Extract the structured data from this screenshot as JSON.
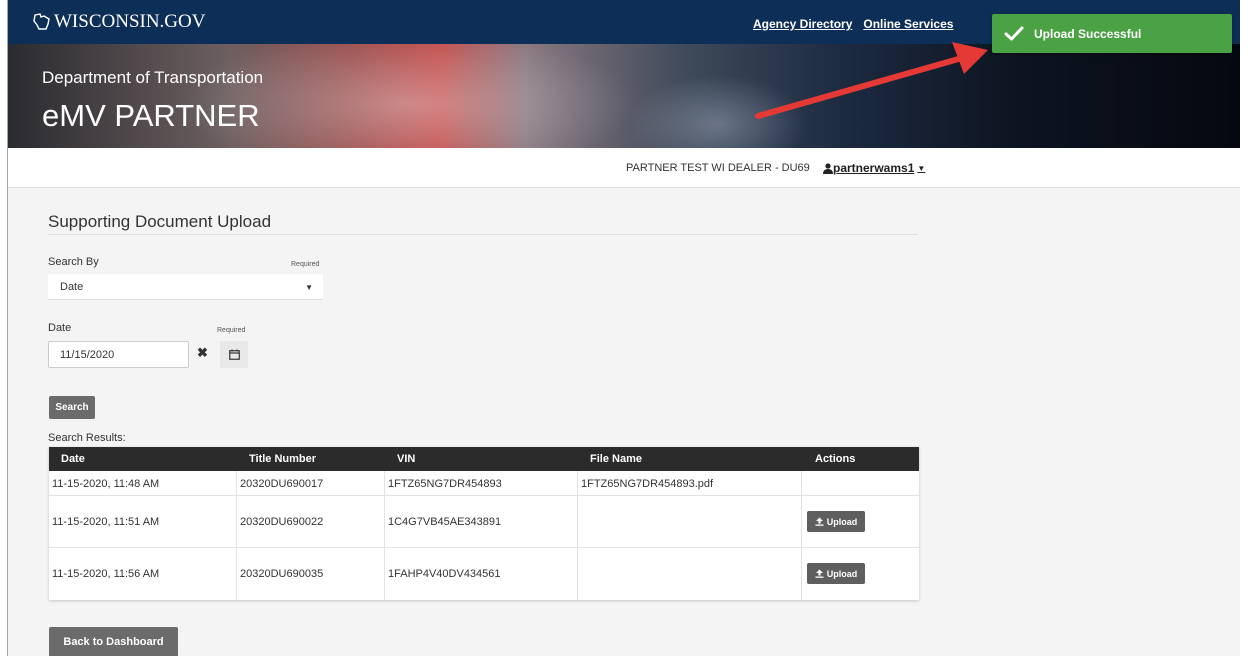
{
  "header": {
    "logo_text": "WISCONSIN.GOV",
    "links": [
      "Agency Directory",
      "Online Services"
    ]
  },
  "banner": {
    "department": "Department of Transportation",
    "app_name": "eMV PARTNER"
  },
  "toast": {
    "message": "Upload Successful",
    "color": "#4aa245"
  },
  "userbar": {
    "dealer": "PARTNER TEST WI DEALER - DU69",
    "username": "partnerwams1"
  },
  "page": {
    "title": "Supporting Document Upload",
    "search_by_label": "Search By",
    "search_by_value": "Date",
    "date_label": "Date",
    "date_value": "11/15/2020",
    "required_label": "Required",
    "search_button": "Search",
    "results_label": "Search Results:",
    "back_button": "Back to Dashboard"
  },
  "table": {
    "columns": [
      "Date",
      "Title Number",
      "VIN",
      "File Name",
      "Actions"
    ],
    "rows": [
      {
        "date": "11-15-2020, 11:48 AM",
        "title_number": "20320DU690017",
        "vin": "1FTZ65NG7DR454893",
        "file_name": "1FTZ65NG7DR454893.pdf",
        "action": ""
      },
      {
        "date": "11-15-2020, 11:51 AM",
        "title_number": "20320DU690022",
        "vin": "1C4G7VB45AE343891",
        "file_name": "",
        "action": "Upload"
      },
      {
        "date": "11-15-2020, 11:56 AM",
        "title_number": "20320DU690035",
        "vin": "1FAHP4V40DV434561",
        "file_name": "",
        "action": "Upload"
      }
    ]
  },
  "colors": {
    "topbar": "#0d2e57",
    "annotation_arrow": "#e53935",
    "button": "#6b6b6b",
    "table_header": "#2b2b2b"
  }
}
